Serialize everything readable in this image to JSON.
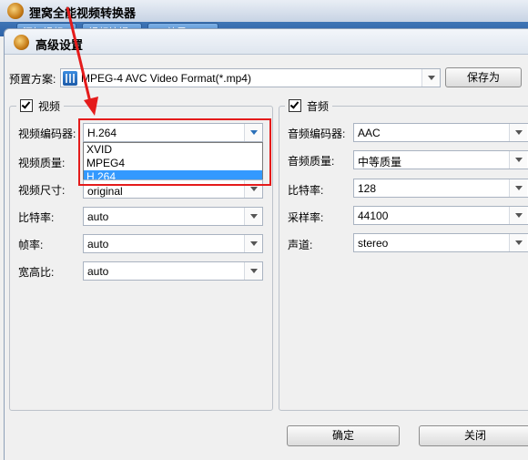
{
  "app": {
    "title": "狸窝全能视频转换器",
    "tabs": [
      "添加视频",
      "视频编辑",
      "3D效果"
    ]
  },
  "dialog": {
    "title": "高级设置",
    "preset_label": "预置方案:",
    "preset_value": "MPEG-4 AVC Video Format(*.mp4)",
    "save_as": "保存为",
    "ok": "确定",
    "close": "关闭"
  },
  "video": {
    "enabled": true,
    "title": "视频",
    "encoder_label": "视频编码器:",
    "encoder_value": "H.264",
    "encoder_options": [
      "XVID",
      "MPEG4",
      "H.264"
    ],
    "encoder_selected": "H.264",
    "quality_label": "视频质量:",
    "size_label": "视频尺寸:",
    "size_value": "original",
    "bitrate_label": "比特率:",
    "bitrate_value": "auto",
    "framerate_label": "帧率:",
    "framerate_value": "auto",
    "aspect_label": "宽高比:",
    "aspect_value": "auto"
  },
  "audio": {
    "enabled": true,
    "title": "音频",
    "encoder_label": "音频编码器:",
    "encoder_value": "AAC",
    "quality_label": "音频质量:",
    "quality_value": "中等质量",
    "bitrate_label": "比特率:",
    "bitrate_value": "128",
    "samplerate_label": "采样率:",
    "samplerate_value": "44100",
    "channel_label": "声道:",
    "channel_value": "stereo"
  },
  "colors": {
    "annotation_red": "#e41b1b",
    "selection_blue": "#3399ff"
  }
}
